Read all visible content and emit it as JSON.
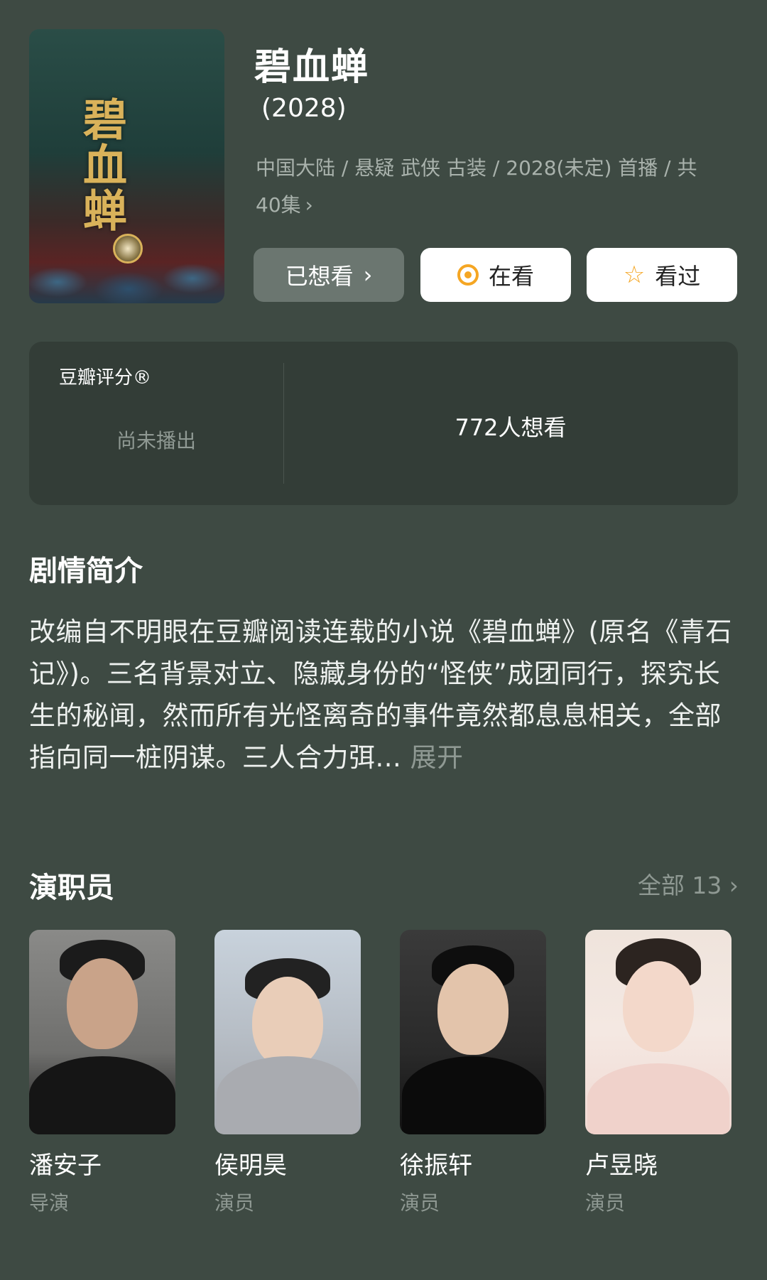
{
  "header": {
    "title": "碧血蝉",
    "year": "(2028)",
    "meta": "中国大陆 / 悬疑 武侠 古装 / 2028(未定) 首播 / 共 40集",
    "meta_chevron": "›",
    "poster_alt_text": "碧血蝉"
  },
  "actions": {
    "wish_label": "已想看",
    "wish_chevron": "›",
    "watching_label": "在看",
    "watched_label": "看过"
  },
  "rating": {
    "label": "豆瓣评分®",
    "status": "尚未播出",
    "wants": "772人想看"
  },
  "synopsis": {
    "title": "剧情简介",
    "text": "改编自不明眼在豆瓣阅读连载的小说《碧血蝉》(原名《青石记》)。三名背景对立、隐藏身份的“怪侠”成团同行，探究长生的秘闻，然而所有光怪离奇的事件竟然都息息相关，全部指向同一桩阴谋。三人合力弭...",
    "expand": "展开"
  },
  "cast": {
    "title": "演职员",
    "all_label": "全部 13 ›",
    "members": [
      {
        "name": "潘安子",
        "role": "导演"
      },
      {
        "name": "侯明昊",
        "role": "演员"
      },
      {
        "name": "徐振轩",
        "role": "演员"
      },
      {
        "name": "卢昱晓",
        "role": "演员"
      }
    ]
  },
  "colors": {
    "background": "#3e4a43",
    "card": "#333d37",
    "accent": "#f5a623",
    "muted_text": "#8f9993"
  }
}
